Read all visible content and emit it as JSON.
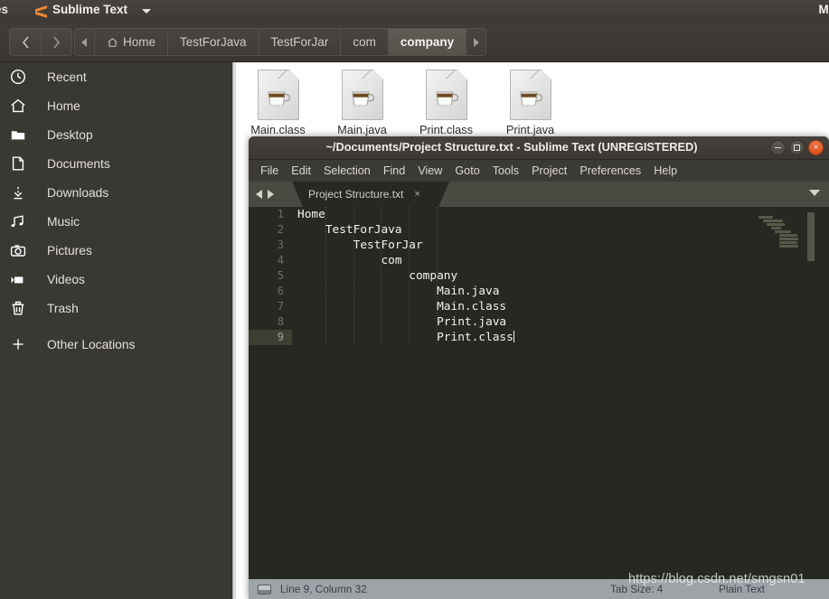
{
  "top_panel": {
    "left_text": "es",
    "app_name": "Sublime Text",
    "logo_icon": "sublime-text-logo-icon",
    "caret_icon": "chevron-down-icon",
    "clock": "Mo"
  },
  "file_manager": {
    "nav": {
      "back_icon": "chevron-left-icon",
      "forward_icon": "chevron-right-icon"
    },
    "breadcrumbs": [
      {
        "label": "",
        "icon": "chevron-left-small-icon",
        "arrow_only": true,
        "active": false
      },
      {
        "label": "Home",
        "icon": "home-icon",
        "arrow_only": false,
        "active": false
      },
      {
        "label": "TestForJava",
        "icon": "",
        "arrow_only": false,
        "active": false
      },
      {
        "label": "TestForJar",
        "icon": "",
        "arrow_only": false,
        "active": false
      },
      {
        "label": "com",
        "icon": "",
        "arrow_only": false,
        "active": false
      },
      {
        "label": "company",
        "icon": "",
        "arrow_only": false,
        "active": true
      },
      {
        "label": "",
        "icon": "chevron-right-small-icon",
        "arrow_only": true,
        "active": false
      }
    ],
    "sidebar": [
      {
        "label": "Recent",
        "icon": "clock-icon"
      },
      {
        "label": "Home",
        "icon": "home-icon"
      },
      {
        "label": "Desktop",
        "icon": "folder-icon"
      },
      {
        "label": "Documents",
        "icon": "document-icon"
      },
      {
        "label": "Downloads",
        "icon": "download-arrow-icon"
      },
      {
        "label": "Music",
        "icon": "music-note-icon"
      },
      {
        "label": "Pictures",
        "icon": "camera-icon"
      },
      {
        "label": "Videos",
        "icon": "video-camera-icon"
      },
      {
        "label": "Trash",
        "icon": "trash-icon"
      },
      {
        "label": "Other Locations",
        "icon": "plus-icon"
      }
    ],
    "files": [
      {
        "name": "Main.class",
        "icon": "java-file-icon"
      },
      {
        "name": "Main.java",
        "icon": "java-file-icon"
      },
      {
        "name": "Print.class",
        "icon": "java-file-icon"
      },
      {
        "name": "Print.java",
        "icon": "java-file-icon"
      }
    ]
  },
  "sublime": {
    "title": "~/Documents/Project Structure.txt - Sublime Text (UNREGISTERED)",
    "window_controls": {
      "minimize_icon": "minimize-icon",
      "maximize_icon": "maximize-icon",
      "close_icon": "close-icon",
      "close_label": "×"
    },
    "menu": [
      "File",
      "Edit",
      "Selection",
      "Find",
      "View",
      "Goto",
      "Tools",
      "Project",
      "Preferences",
      "Help"
    ],
    "tabs": [
      {
        "label": "Project Structure.txt",
        "close_label": "×"
      }
    ],
    "tab_nav": {
      "prev_icon": "triangle-left-icon",
      "next_icon": "triangle-right-icon",
      "dropdown_icon": "chevron-down-icon"
    },
    "editor": {
      "line_numbers": [
        "1",
        "2",
        "3",
        "4",
        "5",
        "6",
        "7",
        "8",
        "9"
      ],
      "lines": [
        "Home",
        "    TestForJava",
        "        TestForJar",
        "            com",
        "                company",
        "                    Main.java",
        "                    Main.class",
        "                    Print.java",
        "                    Print.class"
      ],
      "active_line_index": 8
    },
    "statusbar": {
      "layout_icon": "panel-layout-icon",
      "position": "Line 9, Column 32",
      "tab_size": "Tab Size: 4",
      "syntax": "Plain Text"
    }
  },
  "watermark": "https://blog.csdn.net/smgsn01",
  "colors": {
    "accent_orange": "#f07746",
    "panel_dark": "#3c3934",
    "sidebar_bg": "#3a3833",
    "editor_bg": "#272822",
    "statusbar_bg": "#9ea3a8",
    "active_crumb": "#605c56"
  }
}
